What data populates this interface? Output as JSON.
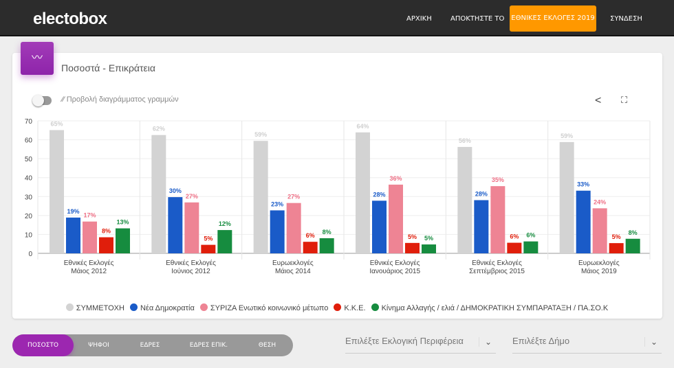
{
  "nav": {
    "logo": "electobox",
    "items": [
      "ΑΡΧΙΚΗ",
      "ΑΠΟΚΤΗΣΤΕ ΤΟ",
      "ΕΘΝΙΚΕΣ ΕΚΛΟΓΕΣ 2019",
      "ΣΥΝΔΕΣΗ"
    ],
    "active_color": "#ff9800"
  },
  "card": {
    "title": "Ποσοστά - Επικράτεια",
    "toggle_label": "Προβολή διαγράμματος γραμμών",
    "toggle_on": false,
    "icons": [
      "line-chart-icon",
      "share-icon",
      "fullscreen-icon"
    ]
  },
  "chart_data": {
    "type": "bar",
    "ylim": [
      0,
      70
    ],
    "yticks": [
      0,
      10,
      20,
      30,
      40,
      50,
      60,
      70
    ],
    "grid": true,
    "legend": "bottom",
    "categories": [
      [
        "Εθνικές Εκλογές",
        "Μάιος 2012"
      ],
      [
        "Εθνικές Εκλογές",
        "Ιούνιος 2012"
      ],
      [
        "Ευρωεκλογές",
        "Μάιος 2014"
      ],
      [
        "Εθνικές Εκλογές",
        "Ιανουάριος 2015"
      ],
      [
        "Εθνικές Εκλογές",
        "Σεπτέμβριος 2015"
      ],
      [
        "Ευρωεκλογές",
        "Μάιος 2019"
      ]
    ],
    "series": [
      {
        "name": "ΣΥΜΜΕΤΟΧΗ",
        "color": "#d3d3d3",
        "label_color": "#cfcfcf",
        "values": [
          65.1,
          62.5,
          59.4,
          63.9,
          56.2,
          58.8
        ]
      },
      {
        "name": "Νέα Δημοκρατία",
        "color": "#1a5bc8",
        "label_color": "#1a5bc8",
        "values": [
          18.9,
          29.7,
          22.7,
          27.8,
          28.1,
          33.1
        ]
      },
      {
        "name": "ΣΥΡΙΖΑ Ενωτικό κοινωνικό μέτωπο",
        "color": "#ee8494",
        "label_color": "#ee6f85",
        "values": [
          16.8,
          26.9,
          26.6,
          36.3,
          35.5,
          23.8
        ]
      },
      {
        "name": "Κ.Κ.Ε.",
        "color": "#e01e0b",
        "label_color": "#e01e0b",
        "values": [
          8.5,
          4.5,
          6.1,
          5.5,
          5.6,
          5.4
        ]
      },
      {
        "name": "Κίνημα Αλλαγής / ελιά / ΔΗΜΟΚΡΑΤΙΚΗ ΣΥΜΠΑΡΑΤΑΞΗ / ΠΑ.ΣΟ.Κ",
        "color": "#168c3f",
        "label_color": "#168c3f",
        "values": [
          13.2,
          12.3,
          8.0,
          4.7,
          6.3,
          7.7
        ]
      }
    ],
    "data_labels": [
      [
        "65%",
        "62%",
        "59%",
        "64%",
        "56%",
        "59%"
      ],
      [
        "19%",
        "30%",
        "23%",
        "28%",
        "28%",
        "33%"
      ],
      [
        "17%",
        "27%",
        "27%",
        "36%",
        "35%",
        "24%"
      ],
      [
        "8%",
        "5%",
        "6%",
        "5%",
        "6%",
        "5%"
      ],
      [
        "13%",
        "12%",
        "8%",
        "5%",
        "6%",
        "8%"
      ]
    ]
  },
  "tabs": {
    "items": [
      "ΠΟΣΟΣΤΟ",
      "ΨΗΦΟΙ",
      "ΕΔΡΕΣ",
      "ΕΔΡΕΣ ΕΠΙΚ.",
      "ΘΕΣΗ"
    ],
    "active": 0,
    "active_color": "#9c27b0"
  },
  "filters": {
    "region_placeholder": "Επιλέξτε Εκλογική Περιφέρεια",
    "municipality_placeholder": "Επιλέξτε Δήμο"
  }
}
